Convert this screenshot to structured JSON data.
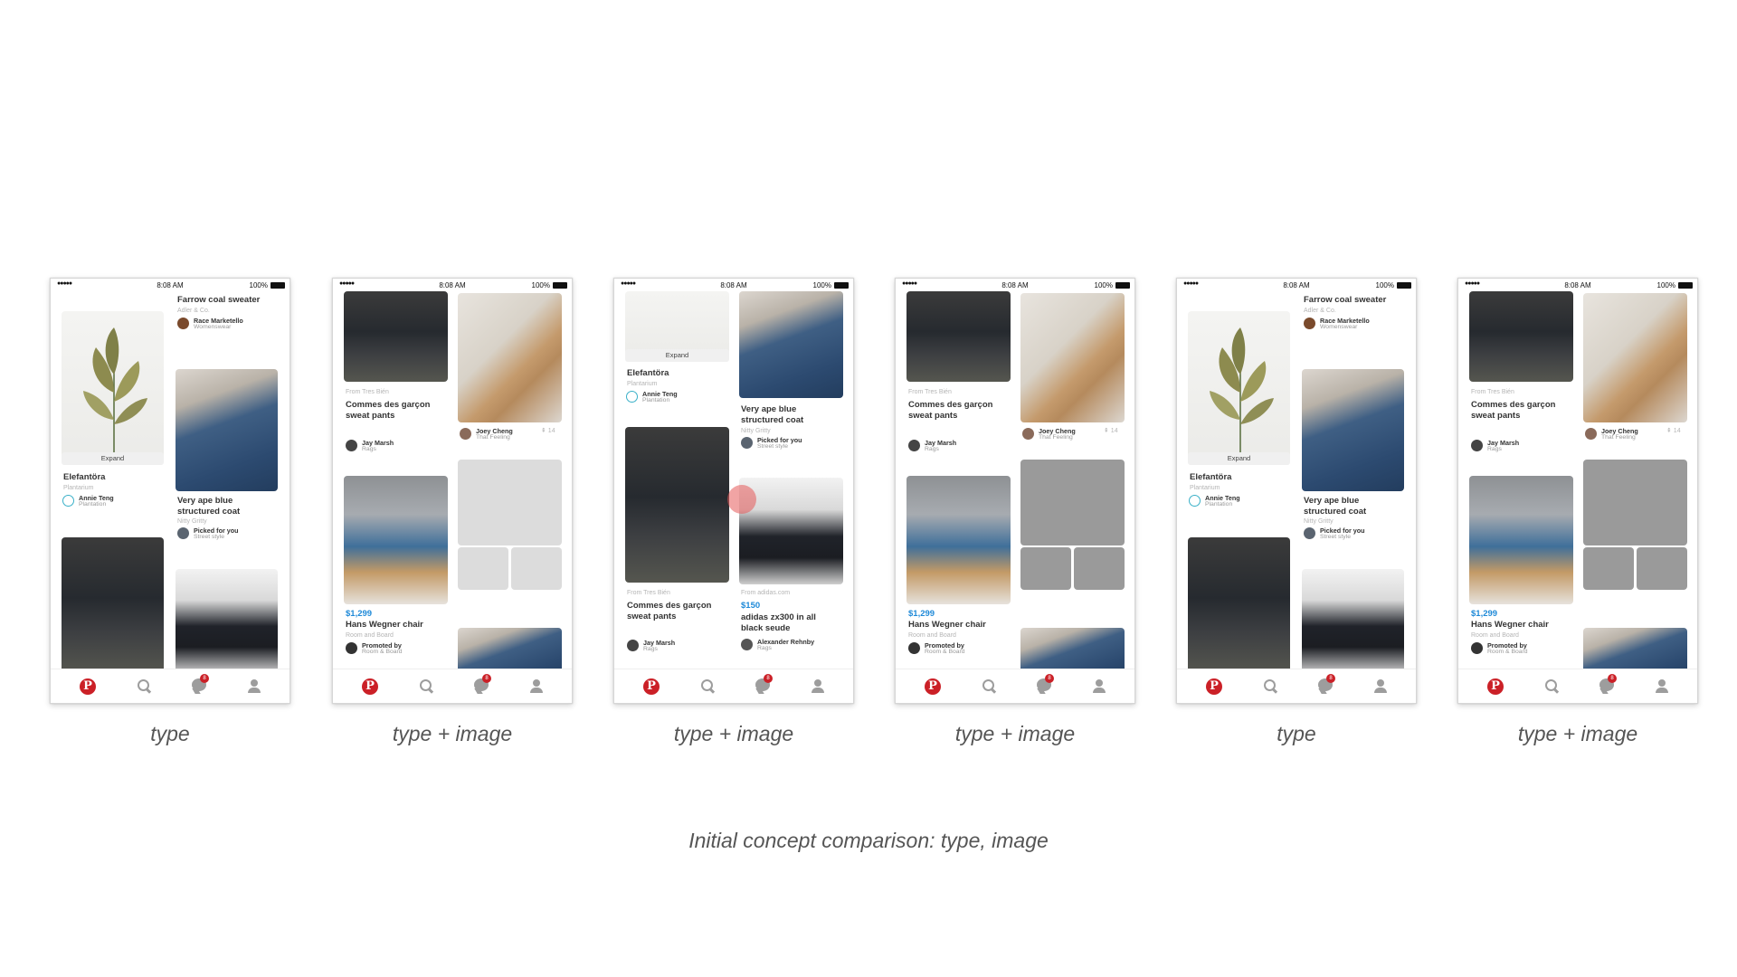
{
  "status": {
    "signal": "●●●●● ",
    "time": "8:08 AM",
    "battery": "100%"
  },
  "tabbar": {
    "logo_glyph": "P",
    "badge": "8"
  },
  "pins": {
    "farrow": {
      "title": "Farrow coal sweater",
      "sub": "Adler & Co.",
      "user": "Race Marketello",
      "board": "Womenswear"
    },
    "elefantora": {
      "title": "Elefantöra",
      "sub": "Plantarium",
      "user": "Annie Teng",
      "board": "Plantation",
      "expand": "Expand"
    },
    "bape": {
      "title": "Very ape blue structured coat",
      "sub": "Nitty Gritty",
      "user": "Picked for you",
      "board": "Street style"
    },
    "commes": {
      "from": "From Tres Bién",
      "title": "Commes des garçon sweat pants",
      "user": "Jay Marsh",
      "board": "Rags"
    },
    "joey": {
      "user": "Joey Cheng",
      "board": "That Feeling",
      "count": "⇞ 14"
    },
    "chair": {
      "price": "$1,299",
      "title": "Hans Wegner chair",
      "sub": "Room and Board",
      "user": "Promoted by",
      "board": "Room & Board",
      "more": "···"
    },
    "adidas": {
      "from": "From adidas.com",
      "price": "$150",
      "title": "adidas zx300 in all black seude",
      "user": "Alexander Rehnby",
      "board": "Rags"
    }
  },
  "captions": [
    "type",
    "type + image",
    "type + image",
    "type + image",
    "type",
    "type + image"
  ],
  "main_caption": "Initial concept comparison: type, image"
}
